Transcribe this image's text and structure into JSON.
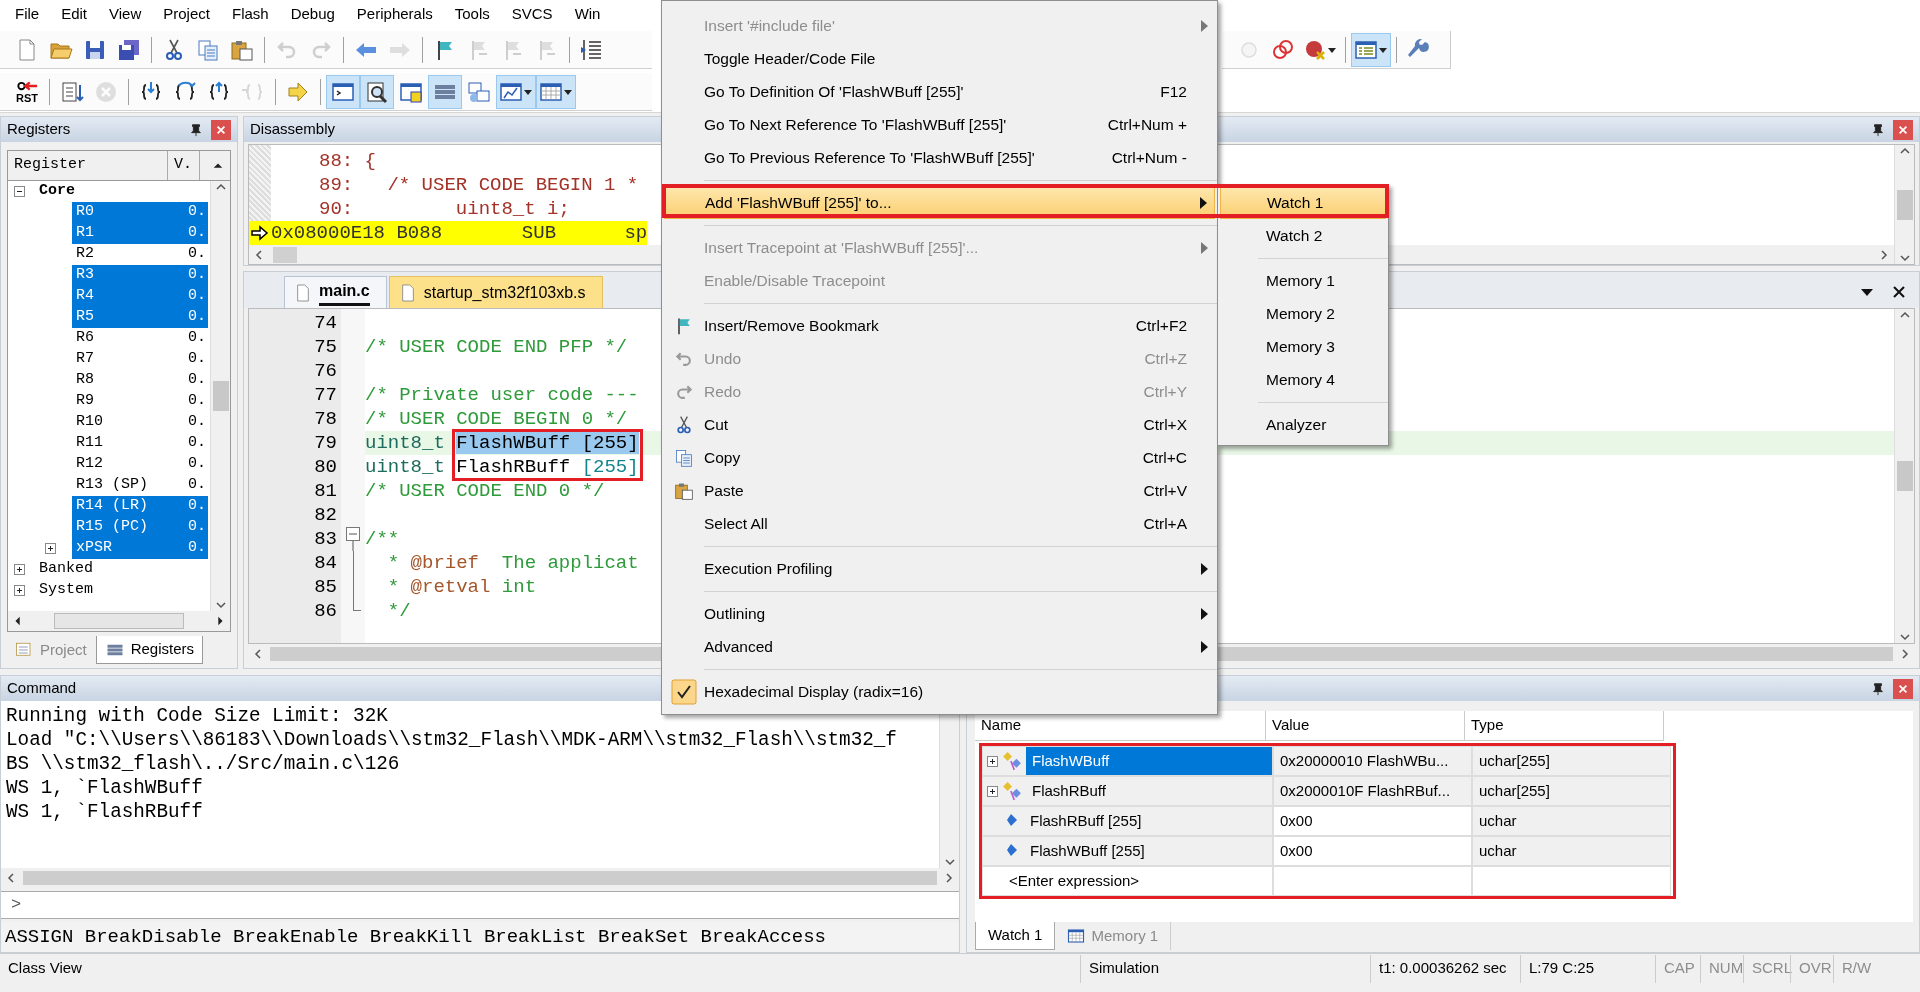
{
  "menu_bar": [
    "File",
    "Edit",
    "View",
    "Project",
    "Flash",
    "Debug",
    "Peripherals",
    "Tools",
    "SVCS",
    "Win"
  ],
  "toolbar_1": [
    {
      "kind": "button",
      "disabled": false,
      "pressed": false
    },
    {
      "kind": "button",
      "disabled": false,
      "pressed": false
    },
    {
      "kind": "button",
      "disabled": false,
      "pressed": false
    },
    {
      "kind": "button",
      "disabled": false,
      "pressed": false
    },
    {
      "kind": "separator"
    },
    {
      "kind": "button",
      "disabled": false,
      "pressed": false
    },
    {
      "kind": "button",
      "disabled": false,
      "pressed": false
    },
    {
      "kind": "button",
      "disabled": false,
      "pressed": false
    },
    {
      "kind": "separator"
    },
    {
      "kind": "button",
      "disabled": true,
      "pressed": false
    },
    {
      "kind": "button",
      "disabled": true,
      "pressed": false
    },
    {
      "kind": "separator"
    },
    {
      "kind": "button",
      "disabled": false,
      "pressed": false
    },
    {
      "kind": "button",
      "disabled": true,
      "pressed": false
    },
    {
      "kind": "separator"
    },
    {
      "kind": "button",
      "disabled": false,
      "pressed": false
    },
    {
      "kind": "button",
      "disabled": true,
      "pressed": false
    },
    {
      "kind": "button",
      "disabled": true,
      "pressed": false
    },
    {
      "kind": "button",
      "disabled": true,
      "pressed": false
    },
    {
      "kind": "separator"
    },
    {
      "kind": "button",
      "disabled": false,
      "pressed": false
    }
  ],
  "toolbar_1_right": [
    {
      "kind": "button",
      "disabled": true,
      "pressed": false
    },
    {
      "kind": "button",
      "disabled": false,
      "pressed": false
    },
    {
      "kind": "dropdown",
      "disabled": false,
      "pressed": false
    },
    {
      "kind": "separator"
    },
    {
      "kind": "dropdown",
      "disabled": false,
      "pressed": true
    },
    {
      "kind": "separator"
    },
    {
      "kind": "button",
      "disabled": false,
      "pressed": false
    }
  ],
  "toolbar_2": [
    {
      "kind": "button",
      "disabled": false,
      "pressed": false,
      "label": "RST"
    },
    {
      "kind": "separator"
    },
    {
      "kind": "button",
      "disabled": false,
      "pressed": false
    },
    {
      "kind": "button",
      "disabled": true,
      "pressed": false
    },
    {
      "kind": "separator"
    },
    {
      "kind": "button",
      "disabled": false,
      "pressed": false
    },
    {
      "kind": "button",
      "disabled": false,
      "pressed": false
    },
    {
      "kind": "button",
      "disabled": false,
      "pressed": false
    },
    {
      "kind": "button",
      "disabled": true,
      "pressed": false
    },
    {
      "kind": "separator"
    },
    {
      "kind": "button",
      "disabled": false,
      "pressed": false
    },
    {
      "kind": "separator"
    },
    {
      "kind": "button",
      "disabled": false,
      "pressed": true
    },
    {
      "kind": "button",
      "disabled": false,
      "pressed": true
    },
    {
      "kind": "button",
      "disabled": false,
      "pressed": false
    },
    {
      "kind": "button",
      "disabled": false,
      "pressed": true
    },
    {
      "kind": "button",
      "disabled": false,
      "pressed": false
    },
    {
      "kind": "dropdown",
      "disabled": false,
      "pressed": true
    },
    {
      "kind": "dropdown",
      "disabled": false,
      "pressed": true
    }
  ],
  "registers_panel": {
    "title": "Registers",
    "columns": [
      "Register",
      "V."
    ],
    "tree": [
      {
        "label": "Core",
        "expanded": true,
        "children": [
          {
            "name": "R0",
            "value": "0.",
            "selected": true
          },
          {
            "name": "R1",
            "value": "0.",
            "selected": true
          },
          {
            "name": "R2",
            "value": "0.",
            "selected": false
          },
          {
            "name": "R3",
            "value": "0.",
            "selected": true
          },
          {
            "name": "R4",
            "value": "0.",
            "selected": true
          },
          {
            "name": "R5",
            "value": "0.",
            "selected": true
          },
          {
            "name": "R6",
            "value": "0.",
            "selected": false
          },
          {
            "name": "R7",
            "value": "0.",
            "selected": false
          },
          {
            "name": "R8",
            "value": "0.",
            "selected": false
          },
          {
            "name": "R9",
            "value": "0.",
            "selected": false
          },
          {
            "name": "R10",
            "value": "0.",
            "selected": false
          },
          {
            "name": "R11",
            "value": "0.",
            "selected": false
          },
          {
            "name": "R12",
            "value": "0.",
            "selected": false
          },
          {
            "name": "R13 (SP)",
            "value": "0.",
            "selected": false
          },
          {
            "name": "R14 (LR)",
            "value": "0.",
            "selected": true
          },
          {
            "name": "R15 (PC)",
            "value": "0.",
            "selected": true
          },
          {
            "name": "xPSR",
            "value": "0.",
            "selected": true,
            "expanded": false
          }
        ]
      },
      {
        "label": "Banked",
        "expanded": false
      },
      {
        "label": "System",
        "expanded": false
      }
    ],
    "tabs": [
      {
        "label": "Project",
        "selected": false
      },
      {
        "label": "Registers",
        "selected": true
      }
    ]
  },
  "disassembly": {
    "title": "Disassembly",
    "lines": [
      {
        "kind": "source",
        "text": "88: {"
      },
      {
        "kind": "source",
        "text": "89:   /* USER CODE BEGIN 1 *"
      },
      {
        "kind": "source",
        "text": "90:         uint8_t i;"
      },
      {
        "kind": "current",
        "text": "0x08000E18 B088       SUB      sp"
      }
    ]
  },
  "editor": {
    "tabs": [
      {
        "label": "main.c",
        "selected": true
      },
      {
        "label": "startup_stm32f103xb.s",
        "selected": false
      }
    ],
    "lines": [
      {
        "kind": "plain",
        "number": "74",
        "current": false
      },
      {
        "kind": "plain",
        "number": "75",
        "current": false,
        "segments": [
          {
            "text": "/* USER CODE END PFP */",
            "kind": "comment"
          }
        ]
      },
      {
        "kind": "plain",
        "number": "76",
        "current": false
      },
      {
        "kind": "plain",
        "number": "77",
        "current": false,
        "segments": [
          {
            "text": "/* Private user code ---",
            "kind": "comment"
          }
        ]
      },
      {
        "kind": "plain",
        "number": "78",
        "current": false,
        "segments": [
          {
            "text": "/* USER CODE BEGIN 0 */",
            "kind": "comment"
          }
        ]
      },
      {
        "kind": "plain",
        "number": "79",
        "current": true,
        "segments": [
          {
            "text": "uint8_t ",
            "kind": "type",
            "selected": false
          },
          {
            "text": "FlashWBuff [255]",
            "kind": "plain",
            "selected": true
          }
        ]
      },
      {
        "kind": "plain",
        "number": "80",
        "current": false,
        "segments": [
          {
            "text": "uint8_t ",
            "kind": "type"
          },
          {
            "text": "FlashRBuff ",
            "kind": "plain"
          },
          {
            "text": "[255]",
            "kind": "number"
          }
        ]
      },
      {
        "kind": "plain",
        "number": "81",
        "current": false,
        "segments": [
          {
            "text": "/* USER CODE END 0 */",
            "kind": "comment"
          }
        ]
      },
      {
        "kind": "plain",
        "number": "82",
        "current": false
      },
      {
        "kind": "fold_start",
        "number": "83",
        "current": false,
        "segments": [
          {
            "text": "/**",
            "kind": "comment"
          }
        ]
      },
      {
        "kind": "fold_body",
        "number": "84",
        "current": false,
        "segments": [
          {
            "text": "  * ",
            "kind": "comment"
          },
          {
            "text": "@brief",
            "kind": "doctag"
          },
          {
            "text": "  The applicat",
            "kind": "comment"
          }
        ]
      },
      {
        "kind": "fold_body",
        "number": "85",
        "current": false,
        "segments": [
          {
            "text": "  * ",
            "kind": "comment"
          },
          {
            "text": "@retval",
            "kind": "doctag"
          },
          {
            "text": " int",
            "kind": "comment"
          }
        ]
      },
      {
        "kind": "fold_end",
        "number": "86",
        "current": false,
        "segments": [
          {
            "text": "  */",
            "kind": "comment"
          }
        ]
      }
    ]
  },
  "context_menu": {
    "items": [
      {
        "kind": "item",
        "label": "Insert '#include file'",
        "disabled": true,
        "submenu": true,
        "selected": false,
        "checked": false
      },
      {
        "kind": "item",
        "label": "Toggle Header/Code File",
        "disabled": false,
        "submenu": false,
        "selected": false,
        "checked": false
      },
      {
        "kind": "item",
        "label": "Go To Definition Of 'FlashWBuff [255]'",
        "shortcut": "F12",
        "disabled": false,
        "submenu": false,
        "selected": false,
        "checked": false
      },
      {
        "kind": "item",
        "label": "Go To Next Reference To 'FlashWBuff [255]'",
        "shortcut": "Ctrl+Num +",
        "disabled": false,
        "submenu": false,
        "selected": false,
        "checked": false
      },
      {
        "kind": "item",
        "label": "Go To Previous Reference To 'FlashWBuff [255]'",
        "shortcut": "Ctrl+Num -",
        "disabled": false,
        "submenu": false,
        "selected": false,
        "checked": false
      },
      {
        "kind": "separator"
      },
      {
        "kind": "item",
        "label": "Add 'FlashWBuff [255]' to...",
        "disabled": false,
        "submenu": true,
        "selected": true,
        "checked": false
      },
      {
        "kind": "separator"
      },
      {
        "kind": "item",
        "label": "Insert Tracepoint at 'FlashWBuff [255]'...",
        "disabled": true,
        "submenu": true,
        "selected": false,
        "checked": false
      },
      {
        "kind": "item",
        "label": "Enable/Disable Tracepoint",
        "disabled": true,
        "submenu": false,
        "selected": false,
        "checked": false
      },
      {
        "kind": "separator"
      },
      {
        "kind": "item",
        "label": "Insert/Remove Bookmark",
        "shortcut": "Ctrl+F2",
        "disabled": false,
        "submenu": false,
        "selected": false,
        "checked": false
      },
      {
        "kind": "item",
        "label": "Undo",
        "shortcut": "Ctrl+Z",
        "disabled": true,
        "submenu": false,
        "selected": false,
        "checked": false
      },
      {
        "kind": "item",
        "label": "Redo",
        "shortcut": "Ctrl+Y",
        "disabled": true,
        "submenu": false,
        "selected": false,
        "checked": false
      },
      {
        "kind": "item",
        "label": "Cut",
        "shortcut": "Ctrl+X",
        "disabled": false,
        "submenu": false,
        "selected": false,
        "checked": false
      },
      {
        "kind": "item",
        "label": "Copy",
        "shortcut": "Ctrl+C",
        "disabled": false,
        "submenu": false,
        "selected": false,
        "checked": false
      },
      {
        "kind": "item",
        "label": "Paste",
        "shortcut": "Ctrl+V",
        "disabled": false,
        "submenu": false,
        "selected": false,
        "checked": false
      },
      {
        "kind": "item",
        "label": "Select All",
        "shortcut": "Ctrl+A",
        "disabled": false,
        "submenu": false,
        "selected": false,
        "checked": false
      },
      {
        "kind": "separator"
      },
      {
        "kind": "item",
        "label": "Execution Profiling",
        "disabled": false,
        "submenu": true,
        "selected": false,
        "checked": false
      },
      {
        "kind": "separator"
      },
      {
        "kind": "item",
        "label": "Outlining",
        "disabled": false,
        "submenu": true,
        "selected": false,
        "checked": false
      },
      {
        "kind": "item",
        "label": "Advanced",
        "disabled": false,
        "submenu": true,
        "selected": false,
        "checked": false
      },
      {
        "kind": "separator"
      },
      {
        "kind": "item",
        "label": "Hexadecimal Display (radix=16)",
        "disabled": false,
        "submenu": false,
        "selected": false,
        "checked": true
      }
    ]
  },
  "submenu": {
    "items": [
      {
        "kind": "item",
        "label": "Watch 1",
        "selected": true
      },
      {
        "kind": "item",
        "label": "Watch 2",
        "selected": false
      },
      {
        "kind": "separator"
      },
      {
        "kind": "item",
        "label": "Memory 1",
        "selected": false
      },
      {
        "kind": "item",
        "label": "Memory 2",
        "selected": false
      },
      {
        "kind": "item",
        "label": "Memory 3",
        "selected": false
      },
      {
        "kind": "item",
        "label": "Memory 4",
        "selected": false
      },
      {
        "kind": "separator"
      },
      {
        "kind": "item",
        "label": "Analyzer",
        "selected": false
      }
    ]
  },
  "command": {
    "title": "Command",
    "lines": [
      "Running with Code Size Limit: 32K",
      "Load \"C:\\\\Users\\\\86183\\\\Downloads\\\\stm32_Flash\\\\MDK-ARM\\\\stm32_Flash\\\\stm32_f",
      "BS \\\\stm32_flash\\../Src/main.c\\126",
      "WS 1, `FlashWBuff",
      "WS 1, `FlashRBuff"
    ],
    "prompt": ">",
    "help": "ASSIGN BreakDisable BreakEnable BreakKill BreakList BreakSet BreakAccess"
  },
  "watch": {
    "columns": [
      "Name",
      "Value",
      "Type"
    ],
    "rows": [
      {
        "kind": "array",
        "name": "FlashWBuff",
        "value": "0x20000010 FlashWBu...",
        "type": "uchar[255]",
        "expanded": false,
        "selected": true
      },
      {
        "kind": "array",
        "name": "FlashRBuff",
        "value": "0x2000010F FlashRBuf...",
        "type": "uchar[255]",
        "expanded": false,
        "selected": false
      },
      {
        "kind": "scalar",
        "name": "FlashRBuff [255]",
        "value": "0x00",
        "type": "uchar",
        "selected": false
      },
      {
        "kind": "scalar",
        "name": "FlashWBuff [255]",
        "value": "0x00",
        "type": "uchar",
        "selected": false
      }
    ],
    "enter_row": "<Enter expression>",
    "tabs": [
      {
        "label": "Watch 1",
        "selected": true
      },
      {
        "label": "Memory 1",
        "selected": false
      }
    ]
  },
  "status_bar": [
    {
      "text": "Class View",
      "active": true
    },
    {
      "text": "Simulation",
      "active": true
    },
    {
      "text": "t1: 0.00036262 sec",
      "active": true
    },
    {
      "text": "L:79 C:25",
      "active": true
    },
    {
      "text": "CAP",
      "active": false
    },
    {
      "text": "NUM",
      "active": false
    },
    {
      "text": "SCRL",
      "active": false
    },
    {
      "text": "OVR",
      "active": false
    },
    {
      "text": "R/W",
      "active": false
    }
  ]
}
